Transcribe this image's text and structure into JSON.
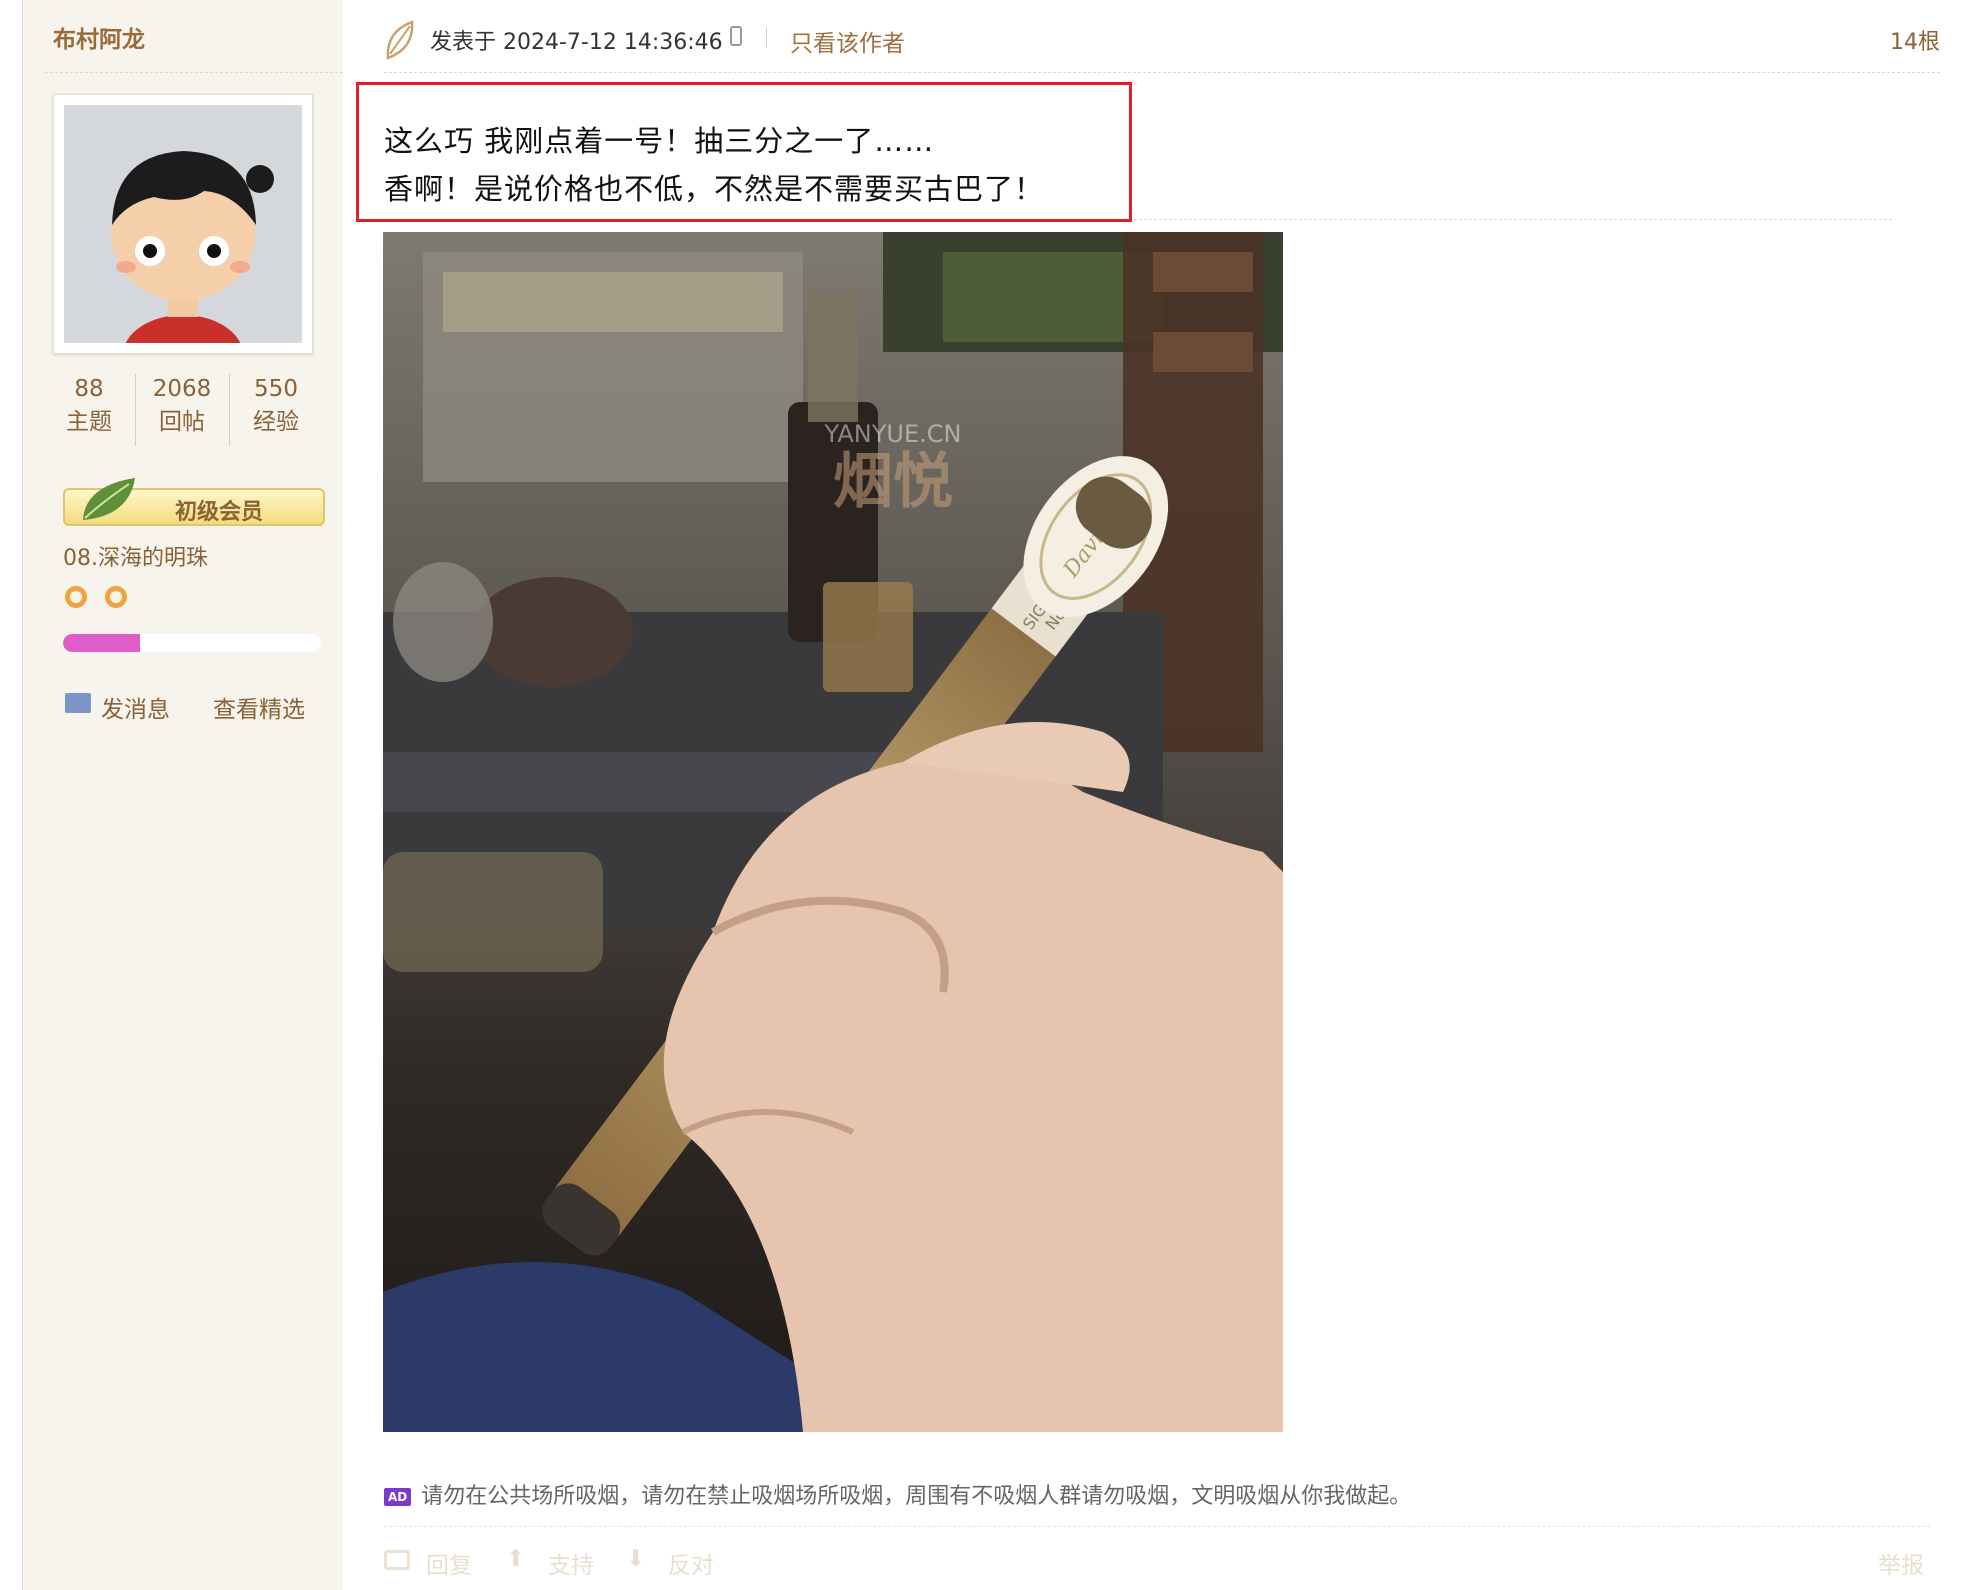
{
  "author": {
    "username": "布村阿龙",
    "stats": [
      {
        "value": "88",
        "label": "主题"
      },
      {
        "value": "2068",
        "label": "回帖"
      },
      {
        "value": "550",
        "label": "经验"
      }
    ],
    "badge_label": "初级会员",
    "rank_name": "08.深海的明珠",
    "rank_progress": 0.3,
    "actions": {
      "message": "发消息",
      "featured": "查看精选"
    }
  },
  "post": {
    "meta": "发表于 2024-7-12 14:36:46",
    "author_only": "只看该作者",
    "floor": "14根",
    "lines": [
      "这么巧 我刚点着一号！抽三分之一了……",
      "香啊！是说价格也不低，不然是不需要买古巴了！"
    ],
    "watermark": {
      "site": "YANYUE.CN",
      "brand": "烟悦"
    },
    "cigar_band": {
      "brand": "Davidoff",
      "model_line1": "SIGNAT",
      "model_line2": "No1"
    },
    "ad_badge": "AD",
    "ad_text": "请勿在公共场所吸烟，请勿在禁止吸烟场所吸烟，周围有不吸烟人群请勿吸烟，文明吸烟从你我做起。"
  },
  "footer": {
    "reply": "回复",
    "support": "支持",
    "oppose": "反对",
    "report": "举报"
  }
}
